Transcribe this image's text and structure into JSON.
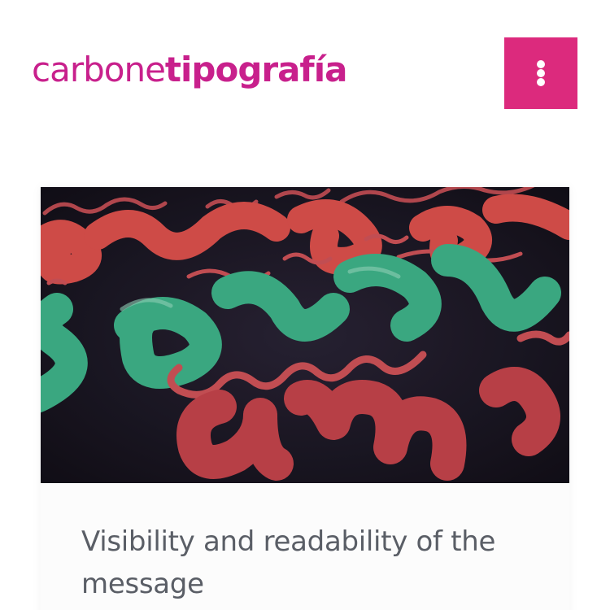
{
  "brand": {
    "name_light": "carbone",
    "name_bold": "tipografía",
    "color": "#c8208c"
  },
  "menu": {
    "icon": "vertical-ellipsis-icon",
    "color": "#dc2a7d"
  },
  "post": {
    "title": "Visibility and readability of the message",
    "image": "lettering-artwork-image"
  }
}
